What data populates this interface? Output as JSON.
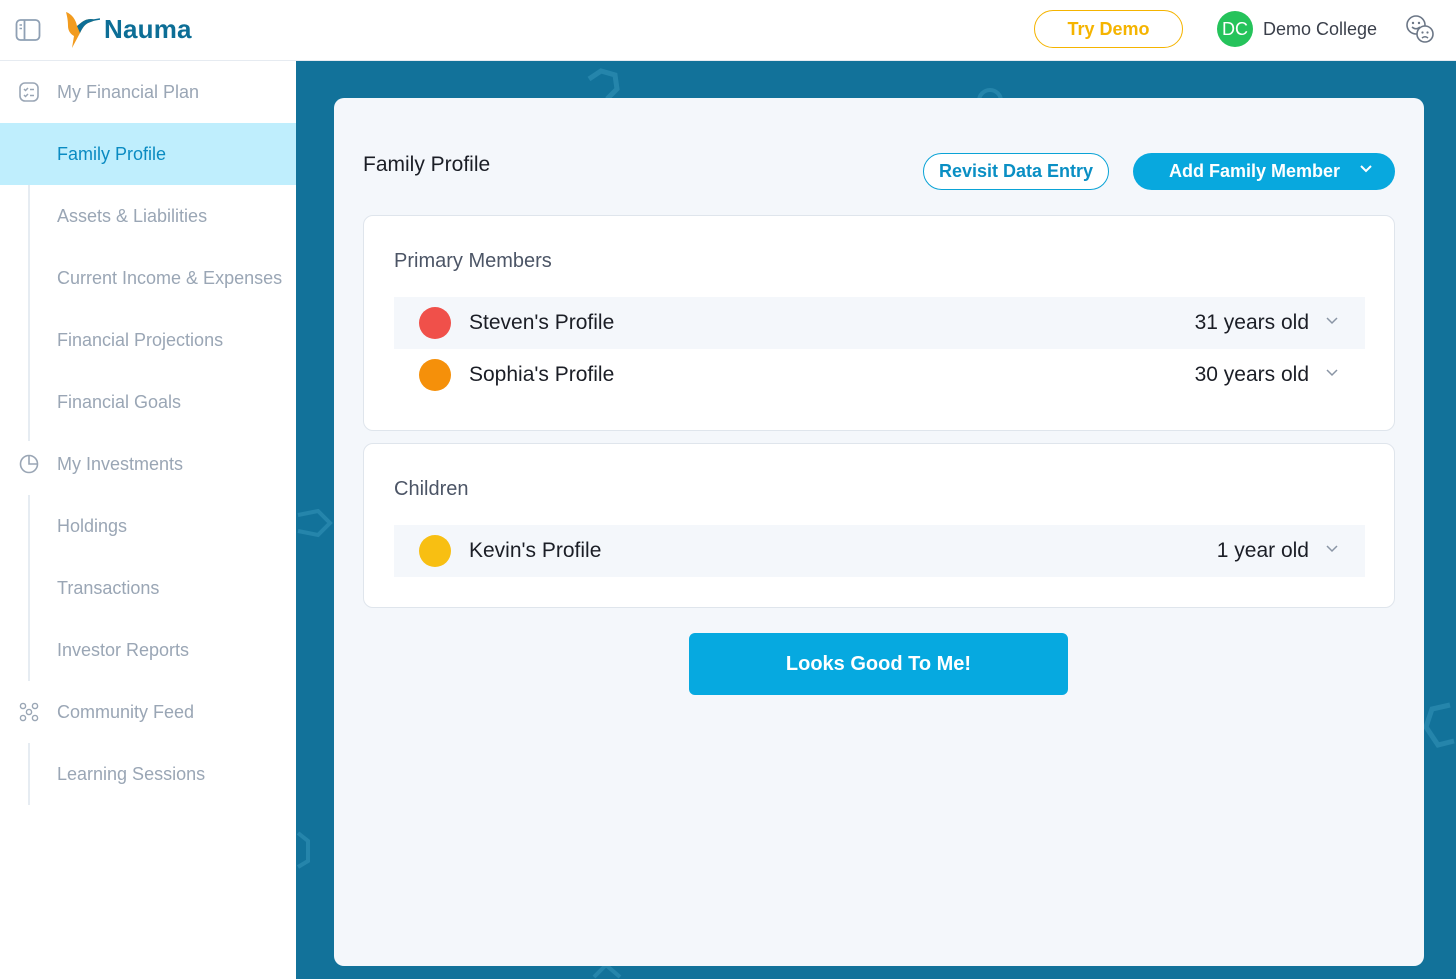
{
  "app": {
    "name": "Nauma",
    "brand_color": "#0d6e96"
  },
  "header": {
    "try_demo_label": "Try Demo",
    "account": {
      "initials": "DC",
      "name": "Demo College",
      "avatar_color": "#25c35b"
    },
    "sidebar_toggle_icon": "sidebar-toggle-icon",
    "feedback_icon": "feedback-faces-icon"
  },
  "sidebar": {
    "sections": [
      {
        "label": "My Financial Plan",
        "icon": "checklist-icon",
        "items": [
          {
            "label": "Family Profile",
            "active": true
          },
          {
            "label": "Assets & Liabilities"
          },
          {
            "label": "Current Income & Expenses"
          },
          {
            "label": "Financial Projections"
          },
          {
            "label": "Financial Goals"
          }
        ]
      },
      {
        "label": "My Investments",
        "icon": "pie-chart-icon",
        "items": [
          {
            "label": "Holdings"
          },
          {
            "label": "Transactions"
          },
          {
            "label": "Investor Reports"
          }
        ]
      },
      {
        "label": "Community Feed",
        "icon": "community-icon",
        "items": [
          {
            "label": "Learning Sessions"
          }
        ]
      }
    ]
  },
  "main": {
    "title": "Family Profile",
    "revisit_label": "Revisit Data Entry",
    "add_member_label": "Add Family Member",
    "primary": {
      "title": "Primary Members",
      "members": [
        {
          "name": "Steven's Profile",
          "age": "31 years old",
          "color": "#f0504a"
        },
        {
          "name": "Sophia's Profile",
          "age": "30 years old",
          "color": "#f5900a"
        }
      ]
    },
    "children": {
      "title": "Children",
      "members": [
        {
          "name": "Kevin's Profile",
          "age": "1 year old",
          "color": "#f8bf12"
        }
      ]
    },
    "confirm_label": "Looks Good To Me!"
  }
}
